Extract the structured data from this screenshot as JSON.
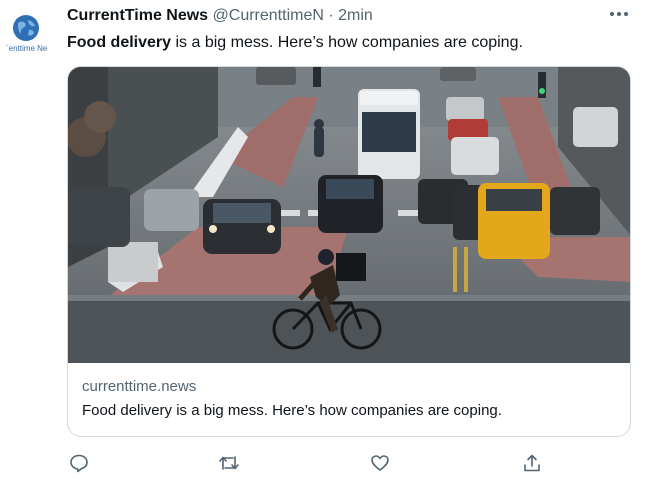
{
  "tweet": {
    "author_name": "CurrentTime News",
    "handle": "@CurrenttimeN",
    "separator": "·",
    "time": "2min",
    "text_bold": "Food delivery",
    "text_rest": " is a big mess. Here’s how companies are coping."
  },
  "avatar": {
    "label": "´enttime Ne"
  },
  "card": {
    "domain": "currenttime.news",
    "title": "Food delivery is a big mess. Here’s how companies are coping."
  },
  "icons": {
    "more": "more-icon",
    "reply": "reply-icon",
    "retweet": "retweet-icon",
    "like": "like-icon",
    "share": "share-icon",
    "avatar_logo": "globe-icon"
  },
  "colors": {
    "text_primary": "#0f1419",
    "text_secondary": "#536471",
    "border": "#cfd9de",
    "avatar_blue": "#2f6fb5"
  }
}
